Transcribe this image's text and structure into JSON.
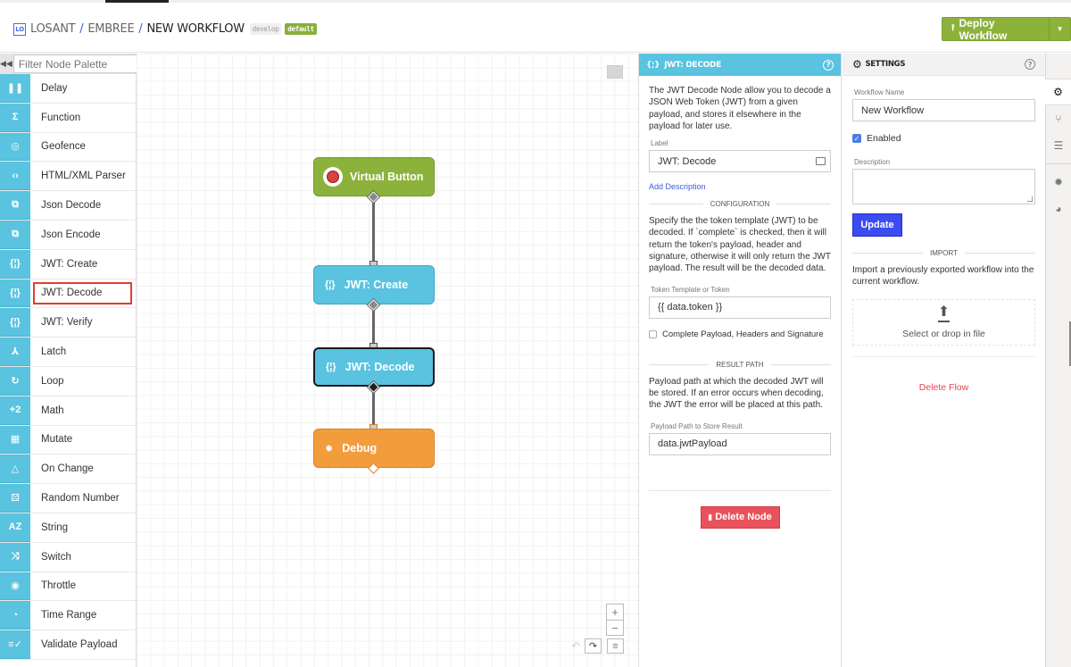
{
  "header": {
    "logo": "LO",
    "breadcrumb": [
      "LOSANT",
      "EMBREE",
      "NEW WORKFLOW"
    ],
    "separator": "/",
    "version_tag": "develop",
    "default_tag": "default",
    "deploy_label": "Deploy Workflow",
    "deploy_icon": "upload-icon",
    "accent": "#8cb23c"
  },
  "palette": {
    "collapse_icon": "double-chevron-left-icon",
    "filter_placeholder": "Filter Node Palette",
    "selected": "JWT: Decode",
    "items": [
      {
        "label": "Delay",
        "icon": "pause-icon",
        "glyph": "❚❚"
      },
      {
        "label": "Function",
        "icon": "sigma-icon",
        "glyph": "Σ"
      },
      {
        "label": "Geofence",
        "icon": "target-icon",
        "glyph": "◎"
      },
      {
        "label": "HTML/XML Parser",
        "icon": "code-icon",
        "glyph": "‹›"
      },
      {
        "label": "Json Decode",
        "icon": "json-decode-icon",
        "glyph": "⧉"
      },
      {
        "label": "Json Encode",
        "icon": "json-encode-icon",
        "glyph": "⧉"
      },
      {
        "label": "JWT: Create",
        "icon": "jwt-create-icon",
        "glyph": "{¦}"
      },
      {
        "label": "JWT: Decode",
        "icon": "jwt-decode-icon",
        "glyph": "{¦}"
      },
      {
        "label": "JWT: Verify",
        "icon": "jwt-verify-icon",
        "glyph": "{¦}"
      },
      {
        "label": "Latch",
        "icon": "latch-icon",
        "glyph": "⅄"
      },
      {
        "label": "Loop",
        "icon": "loop-icon",
        "glyph": "↻"
      },
      {
        "label": "Math",
        "icon": "math-icon",
        "glyph": "+2"
      },
      {
        "label": "Mutate",
        "icon": "mutate-icon",
        "glyph": "▦"
      },
      {
        "label": "On Change",
        "icon": "triangle-icon",
        "glyph": "△"
      },
      {
        "label": "Random Number",
        "icon": "dice-icon",
        "glyph": "⚄"
      },
      {
        "label": "String",
        "icon": "az-icon",
        "glyph": "AZ"
      },
      {
        "label": "Switch",
        "icon": "shuffle-icon",
        "glyph": "⤨"
      },
      {
        "label": "Throttle",
        "icon": "throttle-icon",
        "glyph": "◉"
      },
      {
        "label": "Time Range",
        "icon": "clock-icon",
        "glyph": "◔"
      },
      {
        "label": "Validate Payload",
        "icon": "validate-icon",
        "glyph": "≡✓"
      }
    ]
  },
  "canvas": {
    "nodes": [
      {
        "label": "Virtual Button",
        "type": "trigger",
        "color": "#8cb23c"
      },
      {
        "label": "JWT: Create",
        "type": "logic",
        "color": "#59c3e0",
        "glyph": "{¦}"
      },
      {
        "label": "JWT: Decode",
        "type": "logic",
        "color": "#59c3e0",
        "glyph": "{¦}",
        "selected": true
      },
      {
        "label": "Debug",
        "type": "output",
        "color": "#f39c3c",
        "glyph": "✹"
      }
    ],
    "controls": {
      "zoom_in": "+",
      "zoom_out": "−",
      "undo": "↶",
      "redo": "↷",
      "menu": "≡"
    }
  },
  "node_config": {
    "title": "JWT: DECODE",
    "help": "?",
    "description": "The JWT Decode Node allow you to decode a JSON Web Token (JWT) from a given payload, and stores it elsewhere in the payload for later use.",
    "label_field": {
      "label": "Label",
      "value": "JWT: Decode"
    },
    "add_description": "Add Description",
    "configuration": {
      "heading": "CONFIGURATION",
      "text": "Specify the the token template (JWT) to be decoded. If `complete` is checked, then it will return the token's payload, header and signature, otherwise it will only return the JWT payload. The result will be the decoded data.",
      "token_label": "Token Template or Token",
      "token_value": "{{ data.token }}",
      "complete_label": "Complete Payload, Headers and Signature",
      "complete_checked": false
    },
    "result_path": {
      "heading": "RESULT PATH",
      "text": "Payload path at which the decoded JWT will be stored. If an error occurs when decoding, the JWT the error will be placed at this path.",
      "field_label": "Payload Path to Store Result",
      "value": "data.jwtPayload"
    },
    "delete_label": "Delete Node"
  },
  "settings": {
    "title": "SETTINGS",
    "help": "?",
    "workflow_name_label": "Workflow Name",
    "workflow_name_value": "New Workflow",
    "enabled_label": "Enabled",
    "enabled": true,
    "description_label": "Description",
    "description_value": "",
    "update_label": "Update",
    "import_heading": "IMPORT",
    "import_text": "Import a previously exported workflow into the current workflow.",
    "drop_label": "Select or drop in file",
    "delete_flow_label": "Delete Flow"
  },
  "rail": {
    "tabs": [
      {
        "name": "settings",
        "icon": "gear-icon",
        "glyph": "⚙",
        "active": true
      },
      {
        "name": "versions",
        "icon": "branch-icon",
        "glyph": "⑂"
      },
      {
        "name": "storage",
        "icon": "database-icon",
        "glyph": "☰"
      },
      {
        "name": "debug",
        "icon": "bug-icon",
        "glyph": "✹"
      },
      {
        "name": "globals",
        "icon": "globe-icon",
        "glyph": "◕"
      }
    ]
  }
}
